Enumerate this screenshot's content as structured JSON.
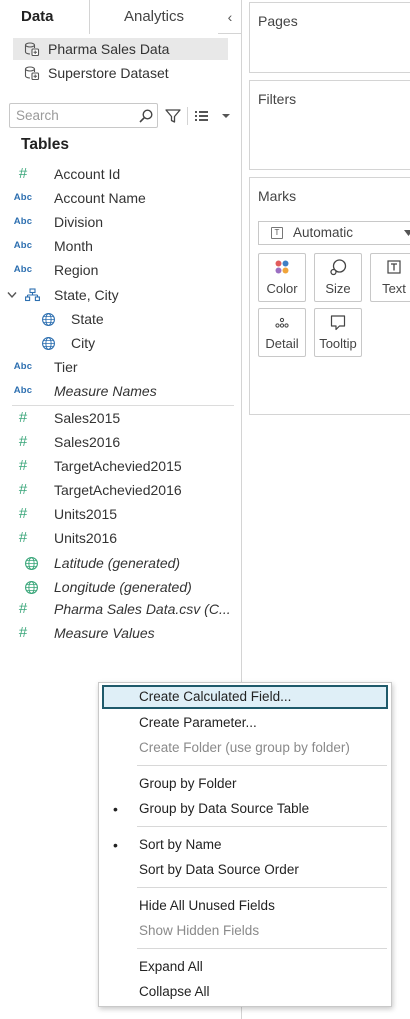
{
  "tabs": {
    "data": "Data",
    "analytics": "Analytics",
    "collapse": "‹"
  },
  "datasources": [
    {
      "name": "Pharma Sales Data",
      "selected": true
    },
    {
      "name": "Superstore Dataset",
      "selected": false
    }
  ],
  "search": {
    "placeholder": "Search",
    "value": ""
  },
  "tables_heading": "Tables",
  "dimensions": [
    {
      "type": "number",
      "name": "Account Id"
    },
    {
      "type": "string",
      "name": "Account Name"
    },
    {
      "type": "string",
      "name": "Division"
    },
    {
      "type": "string",
      "name": "Month"
    },
    {
      "type": "string",
      "name": "Region"
    },
    {
      "type": "hierarchy",
      "name": "State, City"
    },
    {
      "type": "geo",
      "name": "State"
    },
    {
      "type": "geo",
      "name": "City"
    },
    {
      "type": "string",
      "name": "Tier"
    },
    {
      "type": "string",
      "name": "Measure Names"
    }
  ],
  "measures": [
    {
      "type": "number",
      "name": "Sales2015"
    },
    {
      "type": "number",
      "name": "Sales2016"
    },
    {
      "type": "number",
      "name": "TargetAchevied2015"
    },
    {
      "type": "number",
      "name": "TargetAchevied2016"
    },
    {
      "type": "number",
      "name": "Units2015"
    },
    {
      "type": "number",
      "name": "Units2016"
    },
    {
      "type": "geo",
      "name": "Latitude (generated)"
    },
    {
      "type": "geo",
      "name": "Longitude (generated)"
    },
    {
      "type": "number",
      "name": "Pharma Sales Data.csv (C..."
    },
    {
      "type": "number",
      "name": "Measure Values"
    }
  ],
  "type_badges": {
    "string": "Abc",
    "number": "#"
  },
  "shelves": {
    "pages": "Pages",
    "filters": "Filters",
    "marks": "Marks"
  },
  "marks": {
    "type": "Automatic",
    "type_icon": "T",
    "buttons": {
      "color": "Color",
      "size": "Size",
      "text": "Text",
      "detail": "Detail",
      "tooltip": "Tooltip"
    }
  },
  "menu": {
    "create_calc": "Create Calculated Field...",
    "create_param": "Create Parameter...",
    "create_folder": "Create Folder (use group by folder)",
    "group_folder": "Group by Folder",
    "group_source": "Group by Data Source Table",
    "sort_name": "Sort by Name",
    "sort_source": "Sort by Data Source Order",
    "hide_unused": "Hide All Unused Fields",
    "show_hidden": "Show Hidden Fields",
    "expand_all": "Expand All",
    "collapse_all": "Collapse All",
    "bullet": "•"
  },
  "colors": {
    "accent_green": "#3aa67a",
    "abc_blue": "#2d6fb0",
    "menu_highlight_border": "#1f5a6b",
    "menu_highlight_bg": "#dfeff7"
  }
}
